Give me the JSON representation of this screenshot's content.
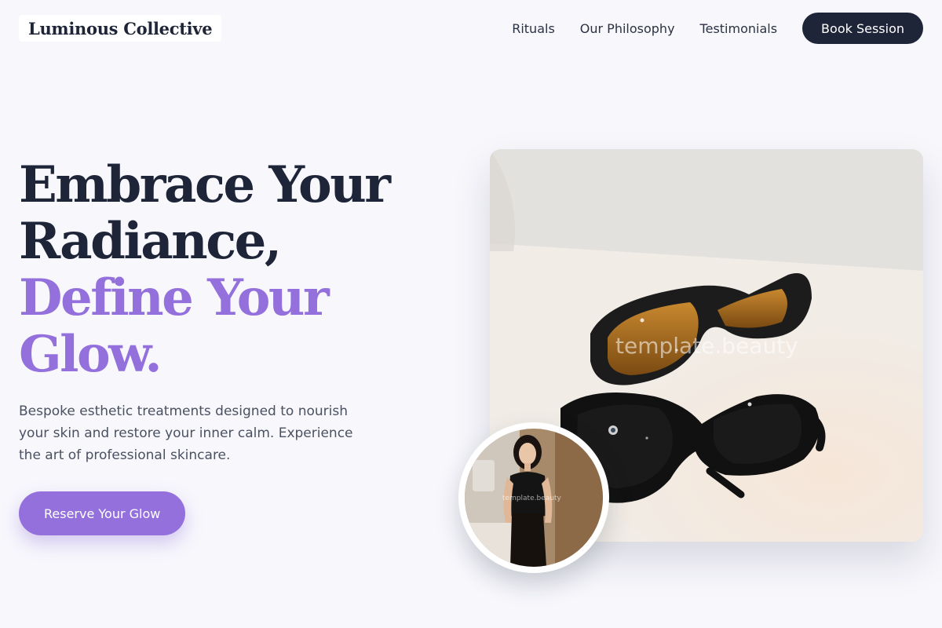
{
  "header": {
    "logo": "Luminous Collective",
    "nav": [
      "Rituals",
      "Our Philosophy",
      "Testimonials"
    ],
    "cta_label": "Book Session"
  },
  "hero": {
    "headline_lines": [
      "Embrace Your",
      "Radiance,"
    ],
    "accent_lines": [
      "Define Your",
      "Glow."
    ],
    "subtitle": "Bespoke esthetic treatments designed to nourish your skin and restore your inner calm. Experience the art of professional skincare.",
    "cta_label": "Reserve Your Glow",
    "image_watermark": "template.beauty",
    "portrait_watermark": "template.beauty"
  },
  "colors": {
    "background": "#f7f7fc",
    "dark": "#1e2538",
    "accent": "#9370db"
  }
}
